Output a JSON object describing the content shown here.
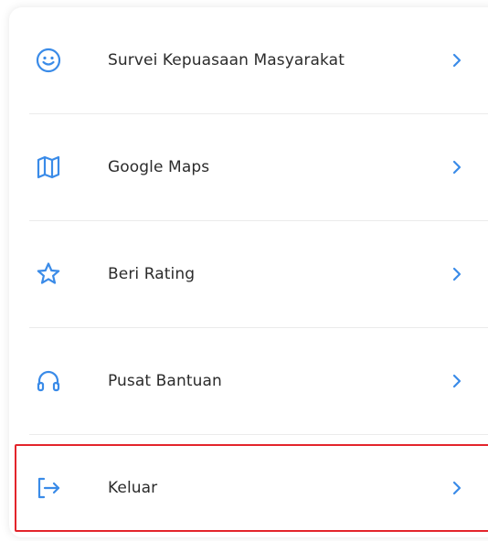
{
  "menu": {
    "items": [
      {
        "label": "Survei Kepuasaan Masyarakat",
        "icon": "smiley-icon"
      },
      {
        "label": "Google Maps",
        "icon": "map-icon"
      },
      {
        "label": "Beri Rating",
        "icon": "star-icon"
      },
      {
        "label": "Pusat Bantuan",
        "icon": "headset-icon"
      },
      {
        "label": "Keluar",
        "icon": "logout-icon"
      }
    ]
  },
  "colors": {
    "icon": "#3a8be8",
    "text": "#2b2b2b",
    "divider": "#ebebeb",
    "highlight": "#e3242b"
  }
}
